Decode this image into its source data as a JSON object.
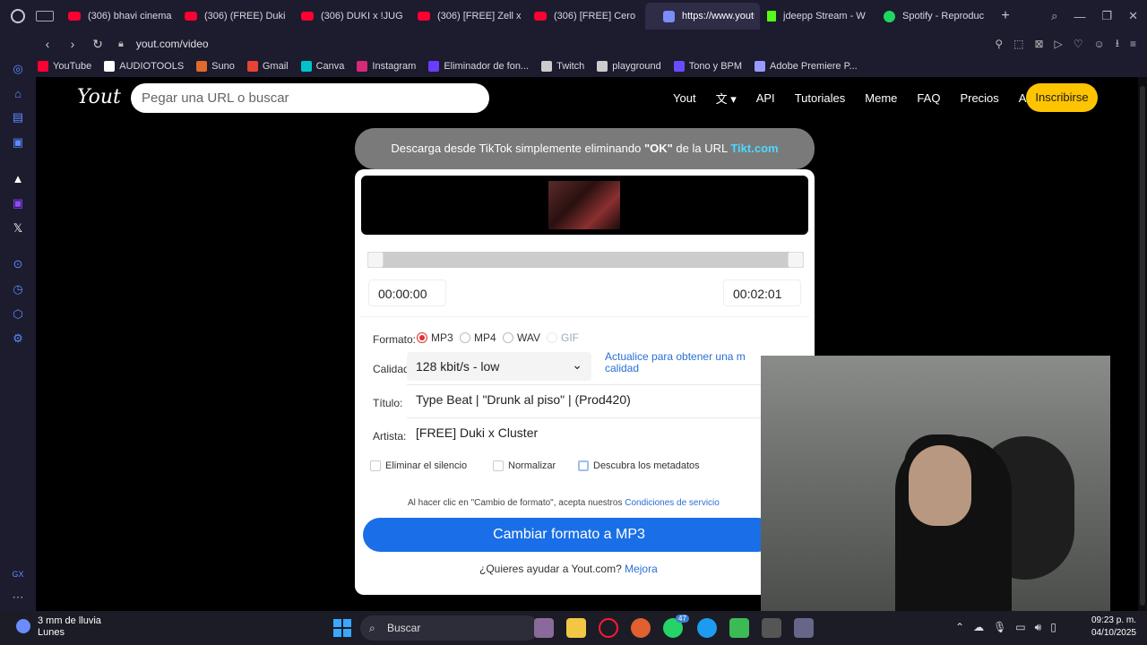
{
  "tabs": [
    {
      "label": "(306) bhavi cinema",
      "icon": "youtube-icon"
    },
    {
      "label": "(306) (FREE) Duki",
      "icon": "youtube-icon"
    },
    {
      "label": "(306) DUKI x !JUG",
      "icon": "youtube-icon"
    },
    {
      "label": "(306) [FREE] Zell x",
      "icon": "youtube-icon"
    },
    {
      "label": "(306) [FREE] Cero",
      "icon": "youtube-icon"
    },
    {
      "label": "https://www.youtube.co",
      "icon": "link-icon",
      "active": true
    },
    {
      "label": "jdeepp Stream - W",
      "icon": "kick-icon"
    },
    {
      "label": "Spotify - Reproduc",
      "icon": "spotify-icon"
    }
  ],
  "address": {
    "url": "yout.com/video"
  },
  "bookmarks": [
    {
      "label": "YouTube",
      "color": "#ff0033"
    },
    {
      "label": "AUDIOTOOLS",
      "color": "#ffffff"
    },
    {
      "label": "Suno",
      "color": "#e06a2a"
    },
    {
      "label": "Gmail",
      "color": "#ea4335"
    },
    {
      "label": "Canva",
      "color": "#00c4cc"
    },
    {
      "label": "Instagram",
      "color": "#d62976"
    },
    {
      "label": "Eliminador de fon...",
      "color": "#6a3cff"
    },
    {
      "label": "Twitch",
      "color": "#cccccc"
    },
    {
      "label": "playground",
      "color": "#cccccc"
    },
    {
      "label": "Tono y BPM",
      "color": "#6a4cff"
    },
    {
      "label": "Adobe Premiere P...",
      "color": "#9999ff"
    }
  ],
  "site": {
    "logo": "Yout",
    "search_placeholder": "Pegar una URL o buscar",
    "nav": [
      "Yout",
      "文",
      "API",
      "Tutoriales",
      "Meme",
      "FAQ",
      "Precios",
      "Acceso"
    ],
    "subscribe": "Inscribirse"
  },
  "banner": {
    "pre": "Descarga desde TikTok simplemente eliminando ",
    "bold": "\"OK\"",
    "mid": " de la URL ",
    "link": "Tikt.com"
  },
  "editor": {
    "start_time": "00:00:00",
    "end_time": "00:02:01",
    "format_label": "Formato:",
    "formats": [
      "MP3",
      "MP4",
      "WAV",
      "GIF"
    ],
    "selected_format": "MP3",
    "quality_label": "Calidad:",
    "quality_value": "128 kbit/s - low",
    "upgrade_text": "Actualice para obtener una m calidad",
    "title_label": "Título:",
    "title_value": "Type Beat | \"Drunk al piso\" | (Prod420)",
    "artist_label": "Artista:",
    "artist_value": "[FREE] Duki x Cluster",
    "options": [
      "Eliminar el silencio",
      "Normalizar",
      "Descubra los metadatos"
    ],
    "terms_pre": "Al hacer clic en \"Cambio de formato\", acepta nuestros ",
    "terms_link": "Condiciones de servicio",
    "convert_button": "Cambiar formato a MP3",
    "help_pre": "¿Quieres ayudar a Yout.com? ",
    "help_link": "Mejora"
  },
  "taskbar": {
    "weather_line1": "3 mm de lluvia",
    "weather_line2": "Lunes",
    "search": "Buscar",
    "time": "09:23 p. m.",
    "date": "04/10/2025",
    "badge": "47"
  }
}
